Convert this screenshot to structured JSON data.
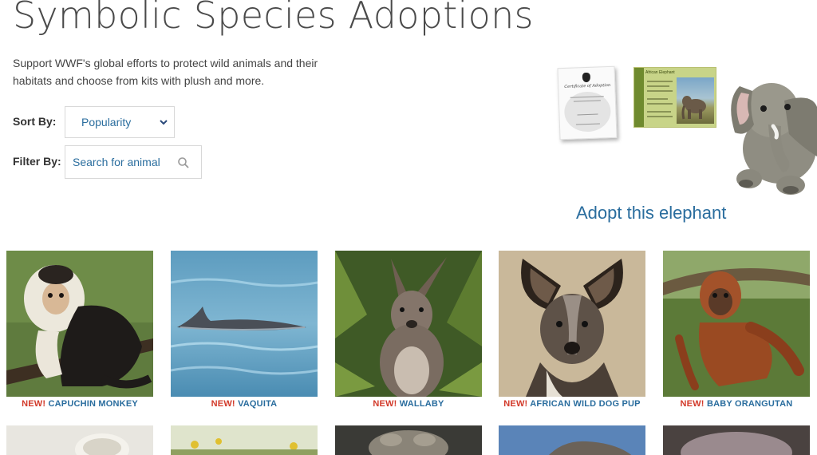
{
  "page": {
    "title": "Symbolic Species Adoptions",
    "intro": "Support WWF's global efforts to protect wild animals and their habitats and choose from kits with plush and more."
  },
  "controls": {
    "sort_label": "Sort By:",
    "sort_value": "Popularity",
    "filter_label": "Filter By:",
    "filter_placeholder": "Search for animal"
  },
  "promo": {
    "certificate_title": "Certificate of Adoption",
    "factsheet_title": "African Elephant",
    "link_text": "Adopt this elephant"
  },
  "animals": [
    {
      "badge": "NEW!",
      "name": "CAPUCHIN MONKEY"
    },
    {
      "badge": "NEW!",
      "name": "VAQUITA"
    },
    {
      "badge": "NEW!",
      "name": "WALLABY"
    },
    {
      "badge": "NEW!",
      "name": "AFRICAN WILD DOG PUP"
    },
    {
      "badge": "NEW!",
      "name": "BABY ORANGUTAN"
    }
  ],
  "colors": {
    "link": "#2a6d9e",
    "new_badge": "#d23a2a"
  }
}
